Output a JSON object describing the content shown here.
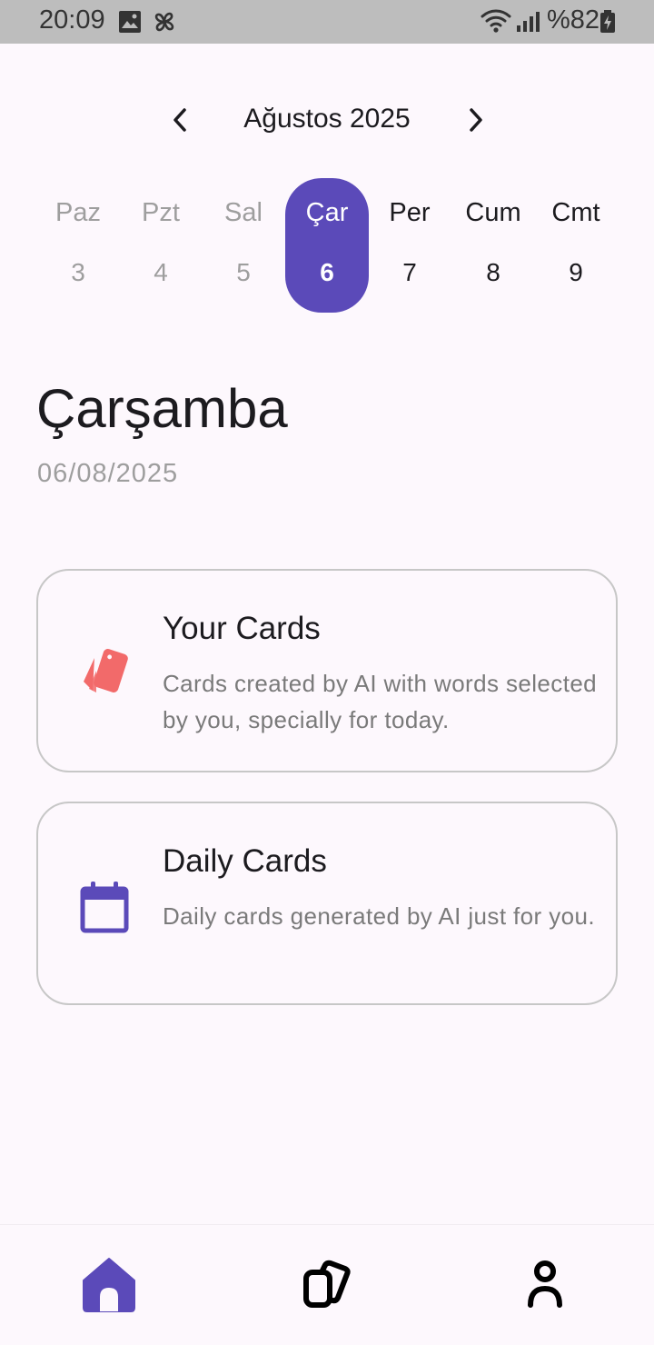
{
  "status_bar": {
    "time": "20:09",
    "battery": "%82"
  },
  "calendar": {
    "month_title": "Ağustos 2025",
    "days": [
      {
        "name": "Paz",
        "num": "3",
        "state": "past"
      },
      {
        "name": "Pzt",
        "num": "4",
        "state": "past"
      },
      {
        "name": "Sal",
        "num": "5",
        "state": "past"
      },
      {
        "name": "Çar",
        "num": "6",
        "state": "selected"
      },
      {
        "name": "Per",
        "num": "7",
        "state": "future"
      },
      {
        "name": "Cum",
        "num": "8",
        "state": "future"
      },
      {
        "name": "Cmt",
        "num": "9",
        "state": "future"
      }
    ]
  },
  "selected_day": {
    "title": "Çarşamba",
    "date": "06/08/2025"
  },
  "cards": [
    {
      "title": "Your Cards",
      "description": "Cards created by AI with words selected by you, specially for today.",
      "icon": "cards-icon"
    },
    {
      "title": "Daily Cards",
      "description": "Daily cards generated by AI just for you.",
      "icon": "calendar-icon"
    }
  ],
  "bottom_nav": [
    {
      "icon": "home-icon",
      "active": true
    },
    {
      "icon": "cards-stack-icon",
      "active": false
    },
    {
      "icon": "profile-icon",
      "active": false
    }
  ],
  "colors": {
    "accent": "#5b4ab9",
    "card_icon_red": "#f26a6a",
    "background": "#fdf8fd"
  }
}
